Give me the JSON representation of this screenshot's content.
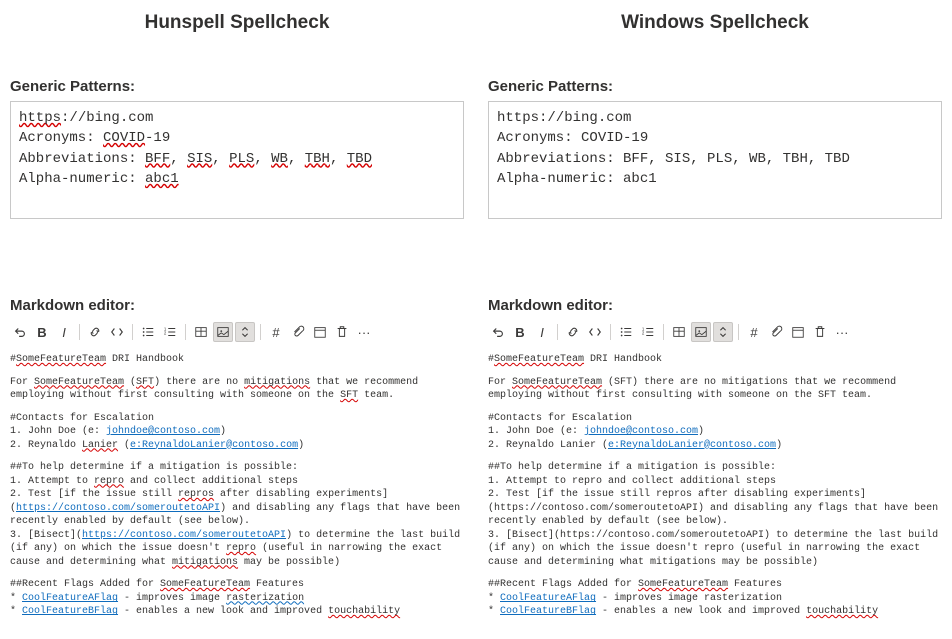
{
  "left": {
    "title": "Hunspell Spellcheck",
    "patternsLabel": "Generic Patterns:",
    "patterns": {
      "https_scheme": "https",
      "url_rest": "://bing.com",
      "acronyms_prefix": "Acronyms: ",
      "acronym_covid": "COVID",
      "acronym_suffix": "-19",
      "abbrev_prefix": "Abbreviations: ",
      "bff": "BFF",
      "sis": "SIS",
      "pls": "PLS",
      "wb": "WB",
      "tbh": "TBH",
      "tbd": "TBD",
      "sep": ", ",
      "alnum_prefix": "Alpha-numeric: ",
      "alnum_val": "abc1"
    },
    "editorLabel": "Markdown editor:",
    "md": {
      "l1_pre": "#",
      "l1_some": "SomeFeatureTeam",
      "l1_rest": " DRI Handbook",
      "p1_a": "For ",
      "p1_some": "SomeFeatureTeam",
      "p1_b": " (",
      "p1_sft": "SFT",
      "p1_c": ") there are no ",
      "p1_mit": "mitigations",
      "p1_d": " that we recommend employing without first consulting with someone on the ",
      "p1_sft2": "SFT",
      "p1_e": " team.",
      "c_head": "#Contacts for Escalation",
      "c1_a": "1. John Doe (e: ",
      "c1_mail": "johndoe@contoso.com",
      "c1_b": ")",
      "c2_a": "2. Reynaldo ",
      "c2_lan": "Lanier",
      "c2_b": " (",
      "c2_mail": "e:ReynaldoLanier@contoso.com",
      "c2_c": ")",
      "h_head": "##To help determine if a mitigation is possible:",
      "s1_a": "1. Attempt to ",
      "s1_repro": "repro",
      "s1_b": " and collect additional steps",
      "s2_a": "2. Test [if the issue still ",
      "s2_repros": "repros",
      "s2_b": " after disabling experiments](",
      "s2_url": "https://contoso.com/someroutetoAPI",
      "s2_c": ") and disabling any flags that have been recently enabled by default (see below).",
      "s3_a": "3. [Bisect](",
      "s3_url": "https://contoso.com/someroutetoAPI",
      "s3_b": ") to determine the last build (if any) on which the issue doesn't ",
      "s3_repro": "repro",
      "s3_c": " (useful in narrowing the exact cause and determining what ",
      "s3_mit": "mitigations",
      "s3_d": " may be possible)",
      "f_head_a": "##Recent Flags Added for ",
      "f_head_some": "SomeFeatureTeam",
      "f_head_b": " Features",
      "f1_a": "* ",
      "f1_flag": "CoolFeatureAFlag",
      "f1_b": " - improves image ",
      "f1_rast": "rasterization",
      "f2_a": "* ",
      "f2_flag": "CoolFeatureBFlag",
      "f2_b": " - enables a new look and improved ",
      "f2_touch": "touchability"
    }
  },
  "right": {
    "title": "Windows Spellcheck",
    "patternsLabel": "Generic Patterns:",
    "patterns": {
      "line1": "https://bing.com",
      "line2": "Acronyms: COVID-19",
      "line3": "Abbreviations: BFF, SIS, PLS, WB, TBH, TBD",
      "line4": "Alpha-numeric: abc1"
    },
    "editorLabel": "Markdown editor:",
    "md": {
      "l1_pre": "#",
      "l1_some": "SomeFeatureTeam",
      "l1_rest": " DRI Handbook",
      "p1_a": "For ",
      "p1_some": "SomeFeatureTeam",
      "p1_b": " (SFT) there are no mitigations that we recommend employing without first consulting with someone on the SFT team.",
      "c_head": "#Contacts for Escalation",
      "c1_a": "1. John Doe (e: ",
      "c1_mail": "johndoe@contoso.com",
      "c1_b": ")",
      "c2_a": "2. Reynaldo Lanier (",
      "c2_mail": "e:ReynaldoLanier@contoso.com",
      "c2_b": ")",
      "h_head": "##To help determine if a mitigation is possible:",
      "s1": "1. Attempt to repro and collect additional steps",
      "s2": "2. Test [if the issue still repros after disabling experiments](https://contoso.com/someroutetoAPI) and disabling any flags that have been recently enabled by default (see below).",
      "s3": "3. [Bisect](https://contoso.com/someroutetoAPI) to determine the last build (if any) on which the issue doesn't repro (useful in narrowing the exact cause and determining what mitigations may be possible)",
      "f_head_a": "##Recent Flags Added for ",
      "f_head_some": "SomeFeatureTeam",
      "f_head_b": " Features",
      "f1_a": "* ",
      "f1_flag": "CoolFeatureAFlag",
      "f1_b": " - improves image rasterization",
      "f2_a": "* ",
      "f2_flag": "CoolFeatureBFlag",
      "f2_b": " - enables a new look and improved ",
      "f2_touch": "touchability"
    }
  },
  "toolbar_icons": [
    "undo",
    "bold",
    "italic",
    "link",
    "code",
    "ul",
    "ol",
    "table",
    "image",
    "updown",
    "hash",
    "paperclip",
    "calendar",
    "trash",
    "more"
  ]
}
